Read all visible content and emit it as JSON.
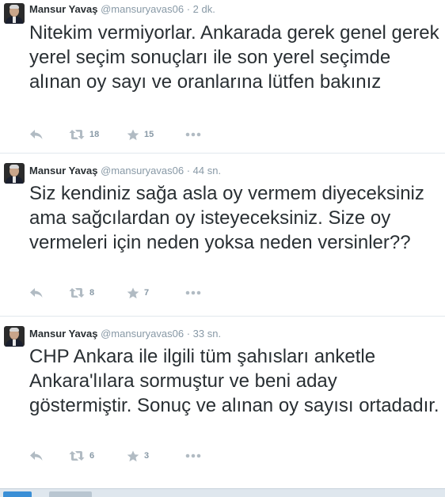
{
  "tweets": [
    {
      "fullname": "Mansur Yavaş",
      "username": "@mansuryavas06",
      "time": "2 dk.",
      "text": "Nitekim vermiyorlar. Ankarada gerek genel gerek yerel seçim sonuçları ile son yerel seçimde alınan oy sayı ve oranlarına lütfen bakınız",
      "retweets": "18",
      "favorites": "15"
    },
    {
      "fullname": "Mansur Yavaş",
      "username": "@mansuryavas06",
      "time": "44 sn.",
      "text": "Siz kendiniz sağa asla oy vermem diyeceksiniz ama sağcılardan oy isteyeceksiniz. Size oy vermeleri için neden yoksa neden versinler??",
      "retweets": "8",
      "favorites": "7"
    },
    {
      "fullname": "Mansur Yavaş",
      "username": "@mansuryavas06",
      "time": "33 sn.",
      "text": "CHP Ankara ile ilgili tüm şahısları anketle Ankara'lılara sormuştur ve beni aday göstermiştir. Sonuç ve alınan oy sayısı ortadadır.",
      "retweets": "6",
      "favorites": "3"
    }
  ],
  "separator": "·",
  "icons": {
    "reply": "reply-icon",
    "retweet": "retweet-icon",
    "favorite": "star-icon",
    "more": "more-icon"
  },
  "colors": {
    "text": "#292f33",
    "muted": "#8899a6",
    "border": "#e1e8ed"
  }
}
